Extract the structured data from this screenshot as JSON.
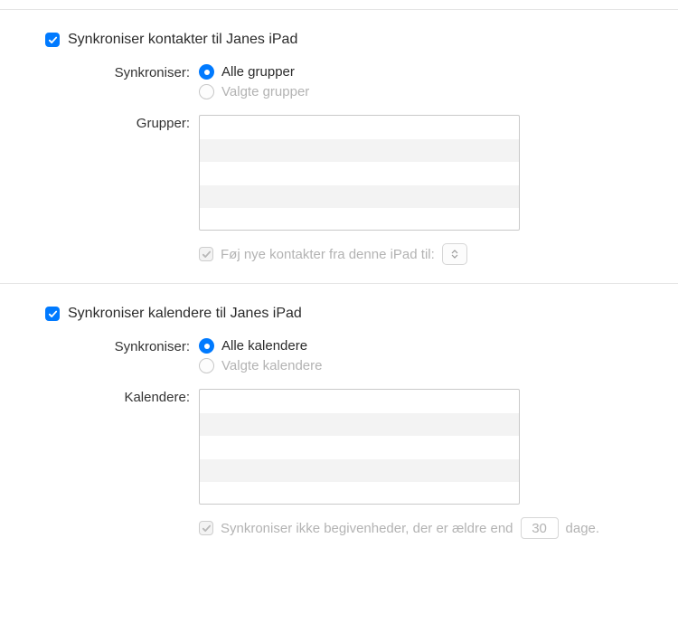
{
  "contacts": {
    "header": "Synkroniser kontakter til Janes iPad",
    "sync_label": "Synkroniser:",
    "radio_all": "Alle grupper",
    "radio_selected": "Valgte grupper",
    "list_label": "Grupper:",
    "add_new_label": "Føj nye kontakter fra denne iPad til:"
  },
  "calendars": {
    "header": "Synkroniser kalendere til Janes iPad",
    "sync_label": "Synkroniser:",
    "radio_all": "Alle kalendere",
    "radio_selected": "Valgte kalendere",
    "list_label": "Kalendere:",
    "older_label": "Synkroniser ikke begivenheder, der er ældre end",
    "days_value": "30",
    "days_suffix": "dage."
  }
}
